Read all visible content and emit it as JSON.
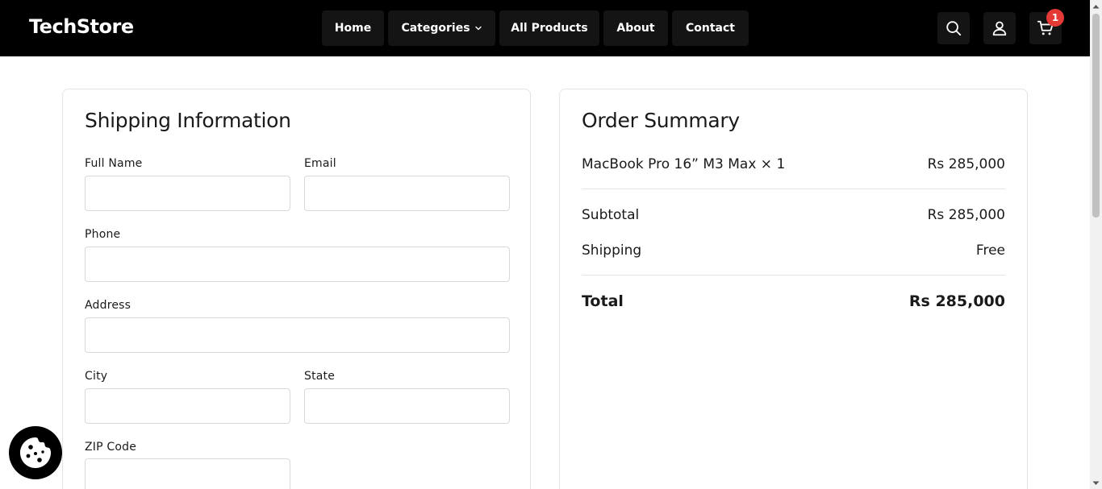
{
  "brand": {
    "name": "TechStore"
  },
  "nav": {
    "home": "Home",
    "categories": "Categories",
    "all_products": "All Products",
    "about": "About",
    "contact": "Contact"
  },
  "header_icons": {
    "search": "search-icon",
    "account": "user-icon",
    "cart": "cart-icon"
  },
  "cart": {
    "count": "1"
  },
  "shipping": {
    "title": "Shipping Information",
    "full_name": {
      "label": "Full Name",
      "value": ""
    },
    "email": {
      "label": "Email",
      "value": ""
    },
    "phone": {
      "label": "Phone",
      "value": ""
    },
    "address": {
      "label": "Address",
      "value": ""
    },
    "city": {
      "label": "City",
      "value": ""
    },
    "state": {
      "label": "State",
      "value": ""
    },
    "zip": {
      "label": "ZIP Code",
      "value": ""
    }
  },
  "order": {
    "title": "Order Summary",
    "items": [
      {
        "name": "MacBook Pro 16” M3 Max × 1",
        "price": "Rs 285,000"
      }
    ],
    "subtotal_label": "Subtotal",
    "subtotal_value": "Rs 285,000",
    "shipping_label": "Shipping",
    "shipping_value": "Free",
    "total_label": "Total",
    "total_value": "Rs 285,000"
  },
  "colors": {
    "header_bg": "#000000",
    "nav_button_bg": "#141414",
    "badge": "#e53935",
    "border": "#e4e4e4"
  }
}
